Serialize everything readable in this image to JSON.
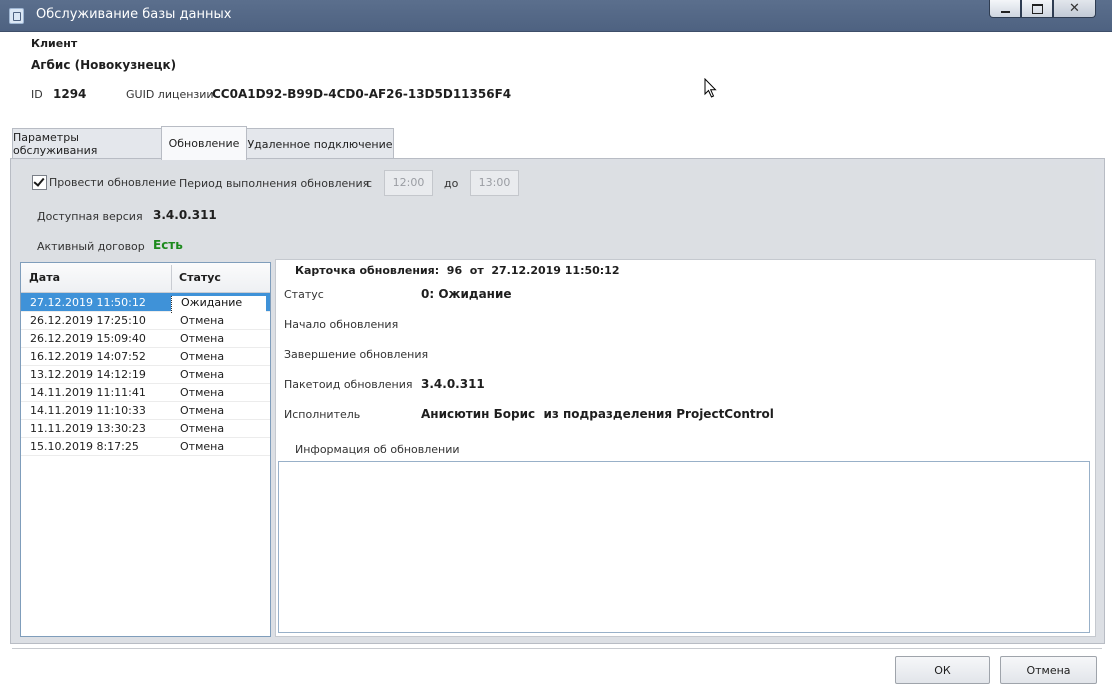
{
  "window": {
    "title": "Обслуживание базы данных",
    "controls": {
      "minimize": "minimize-icon",
      "maximize": "maximize-icon",
      "close": "close-icon"
    }
  },
  "client": {
    "section_label": "Клиент",
    "name": "Агбис (Новокузнецк)",
    "id_label": "ID",
    "id_value": "1294",
    "guid_label": "GUID лицензии",
    "guid_value": "CC0A1D92-B99D-4CD0-AF26-13D5D11356F4"
  },
  "tabs": [
    {
      "label": "Параметры обслуживания",
      "active": false
    },
    {
      "label": "Обновление",
      "active": true
    },
    {
      "label": "Удаленное подключение",
      "active": false
    }
  ],
  "update_settings": {
    "do_update_label": "Провести обновление",
    "do_update_checked": true,
    "period_label": "Период выполнения обновления",
    "from_label": "с",
    "from_value": "12:00",
    "to_label": "до",
    "to_value": "13:00",
    "available_version_label": "Доступная версия",
    "available_version_value": "3.4.0.311",
    "contract_label": "Активный договор",
    "contract_value": "Есть"
  },
  "history": {
    "columns": [
      "Дата",
      "Статус"
    ],
    "rows": [
      {
        "date": "27.12.2019 11:50:12",
        "status": "Ожидание"
      },
      {
        "date": "26.12.2019 17:25:10",
        "status": "Отмена"
      },
      {
        "date": "26.12.2019 15:09:40",
        "status": "Отмена"
      },
      {
        "date": "16.12.2019 14:07:52",
        "status": "Отмена"
      },
      {
        "date": "13.12.2019 14:12:19",
        "status": "Отмена"
      },
      {
        "date": "14.11.2019 11:11:41",
        "status": "Отмена"
      },
      {
        "date": "14.11.2019 11:10:33",
        "status": "Отмена"
      },
      {
        "date": "11.11.2019 13:30:23",
        "status": "Отмена"
      },
      {
        "date": "15.10.2019 8:17:25",
        "status": "Отмена"
      }
    ],
    "selected_index": 0
  },
  "card": {
    "title": "Карточка обновления:  96  от  27.12.2019 11:50:12",
    "status_label": "Статус",
    "status_value": "0: Ожидание",
    "start_label": "Начало обновления",
    "end_label": "Завершение обновления",
    "package_label": "Пакетоид обновления",
    "package_value": "3.4.0.311",
    "executor_label": "Исполнитель",
    "executor_value": "Анисютин Борис  из подразделения ProjectControl",
    "info_label": "Информация об обновлении",
    "info_value": ""
  },
  "buttons": {
    "ok": "ОК",
    "cancel": "Отмена"
  },
  "colors": {
    "titlebar": "#4e6281",
    "selection": "#3f92d8",
    "contract_ok": "#1d8a1d"
  }
}
